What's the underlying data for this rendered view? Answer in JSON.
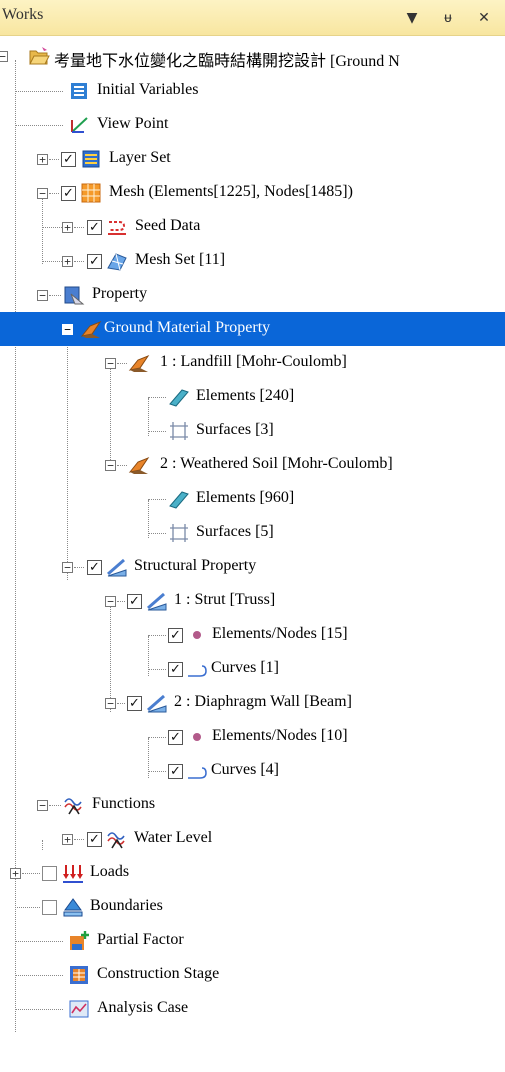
{
  "panel": {
    "title": "Works",
    "btn_dropdown": "▼",
    "btn_pin": "ᵾ",
    "btn_close": "✕"
  },
  "tree": {
    "root": "考量地下水位變化之臨時結構開挖設計 [Ground N",
    "initial_variables": "Initial Variables",
    "view_point": "View Point",
    "layer_set": "Layer Set",
    "mesh": "Mesh (Elements[1225], Nodes[1485])",
    "seed_data": "Seed Data",
    "mesh_set": "Mesh Set [11]",
    "property": "Property",
    "ground_material_property": "Ground Material Property",
    "landfill": "1 : Landfill [Mohr-Coulomb]",
    "landfill_elements": "Elements [240]",
    "landfill_surfaces": "Surfaces [3]",
    "weathered_soil": "2 : Weathered Soil [Mohr-Coulomb]",
    "weathered_elements": "Elements [960]",
    "weathered_surfaces": "Surfaces [5]",
    "structural_property": "Structural Property",
    "strut": "1 : Strut [Truss]",
    "strut_elements_nodes": "Elements/Nodes [15]",
    "strut_curves": "Curves [1]",
    "diaphragm_wall": "2 : Diaphragm Wall [Beam]",
    "wall_elements_nodes": "Elements/Nodes [10]",
    "wall_curves": "Curves [4]",
    "functions": "Functions",
    "water_level": "Water Level",
    "loads": "Loads",
    "boundaries": "Boundaries",
    "partial_factor": "Partial Factor",
    "construction_stage": "Construction Stage",
    "analysis_case": "Analysis Case"
  },
  "glyphs": {
    "expanded": "−",
    "collapsed": "+",
    "checked": "✓"
  },
  "colors": {
    "selection": "#0a66d8",
    "title_bar": "#fdf3c4",
    "tree_lines": "#8a8a8a"
  },
  "icons": {
    "root": "folder-open-icon",
    "initial_variables": "variables-icon",
    "view_point": "view-point-icon",
    "layer_set": "layer-set-icon",
    "mesh": "mesh-grid-icon",
    "seed_data": "seed-data-icon",
    "mesh_set": "mesh-set-icon",
    "property": "property-icon",
    "material": "material-icon",
    "element": "element-icon",
    "surface": "surface-icon",
    "structural": "structural-icon",
    "node_dot": "node-dot-icon",
    "curve": "curve-icon",
    "function": "function-icon",
    "loads": "loads-icon",
    "boundaries": "boundaries-icon",
    "partial_factor": "partial-factor-icon",
    "construction_stage": "construction-stage-icon",
    "analysis_case": "analysis-case-icon"
  }
}
